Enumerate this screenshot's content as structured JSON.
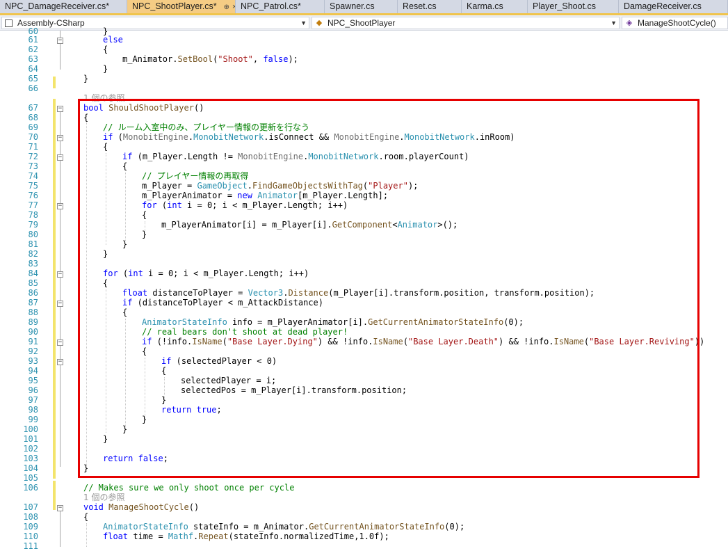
{
  "tabs": [
    {
      "label": "NPC_DamageReceiver.cs*"
    },
    {
      "label": "NPC_ShootPlayer.cs*",
      "pin": "⊕",
      "close": "×"
    },
    {
      "label": "NPC_Patrol.cs*"
    },
    {
      "label": "Spawner.cs"
    },
    {
      "label": "Reset.cs"
    },
    {
      "label": "Karma.cs"
    },
    {
      "label": "Player_Shoot.cs"
    },
    {
      "label": "DamageReceiver.cs"
    }
  ],
  "navbar": {
    "project": "Assembly-CSharp",
    "class": "NPC_ShootPlayer",
    "member": "ManageShootCycle()"
  },
  "references": {
    "before_should_shoot": "1 個の参照",
    "before_manage_cycle": "1 個の参照"
  },
  "line_numbers": [
    "60",
    "61",
    "62",
    "63",
    "64",
    "65",
    "66",
    "67",
    "68",
    "69",
    "70",
    "71",
    "72",
    "73",
    "74",
    "75",
    "76",
    "77",
    "78",
    "79",
    "80",
    "81",
    "82",
    "83",
    "84",
    "85",
    "86",
    "87",
    "88",
    "89",
    "90",
    "91",
    "92",
    "93",
    "94",
    "95",
    "96",
    "97",
    "98",
    "99",
    "100",
    "101",
    "102",
    "103",
    "104",
    "105",
    "106",
    "107",
    "108",
    "109",
    "110",
    "111"
  ],
  "code": {
    "l60": "}",
    "l61": "else",
    "l62": "{",
    "l63": "m_Animator.SetBool(\"Shoot\", false);",
    "l64": "}",
    "l65": "}",
    "l67": "bool ShouldShootPlayer()",
    "l68": "{",
    "l69": "// ルーム入室中のみ、プレイヤー情報の更新を行なう",
    "l70": "if (MonobitEngine.MonobitNetwork.isConnect && MonobitEngine.MonobitNetwork.inRoom)",
    "l71": "{",
    "l72": "if (m_Player.Length != MonobitEngine.MonobitNetwork.room.playerCount)",
    "l73": "{",
    "l74": "// プレイヤー情報の再取得",
    "l75": "m_Player = GameObject.FindGameObjectsWithTag(\"Player\");",
    "l76": "m_PlayerAnimator = new Animator[m_Player.Length];",
    "l77": "for (int i = 0; i < m_Player.Length; i++)",
    "l78": "{",
    "l79": "m_PlayerAnimator[i] = m_Player[i].GetComponent<Animator>();",
    "l80": "}",
    "l81": "}",
    "l82": "}",
    "l84": "for (int i = 0; i < m_Player.Length; i++)",
    "l85": "{",
    "l86": "float distanceToPlayer = Vector3.Distance(m_Player[i].transform.position, transform.position);",
    "l87": "if (distanceToPlayer < m_AttackDistance)",
    "l88": "{",
    "l89": "AnimatorStateInfo info = m_PlayerAnimator[i].GetCurrentAnimatorStateInfo(0);",
    "l90": "// real bears don't shoot at dead player!",
    "l91": "if (!info.IsName(\"Base Layer.Dying\") && !info.IsName(\"Base Layer.Death\") && !info.IsName(\"Base Layer.Reviving\"))",
    "l92": "{",
    "l93": "if (selectedPlayer < 0)",
    "l94": "{",
    "l95": "selectedPlayer = i;",
    "l96": "selectedPos = m_Player[i].transform.position;",
    "l97": "}",
    "l98": "return true;",
    "l99": "}",
    "l100": "}",
    "l101": "}",
    "l103": "return false;",
    "l104": "}",
    "l106": "// Makes sure we only shoot once per cycle",
    "l107": "void ManageShootCycle()",
    "l108": "{",
    "l109": "AnimatorStateInfo stateInfo = m_Animator.GetCurrentAnimatorStateInfo(0);",
    "l110": "float time = Mathf.Repeat(stateInfo.normalizedTime,1.0f);"
  },
  "colors": {
    "keyword": "#0000ff",
    "type": "#2b91af",
    "string": "#a31515",
    "comment": "#008000",
    "method": "#74531f",
    "highlight_box": "#e60000",
    "active_tab": "#f5cc84",
    "change_bar": "#f3e46c"
  }
}
